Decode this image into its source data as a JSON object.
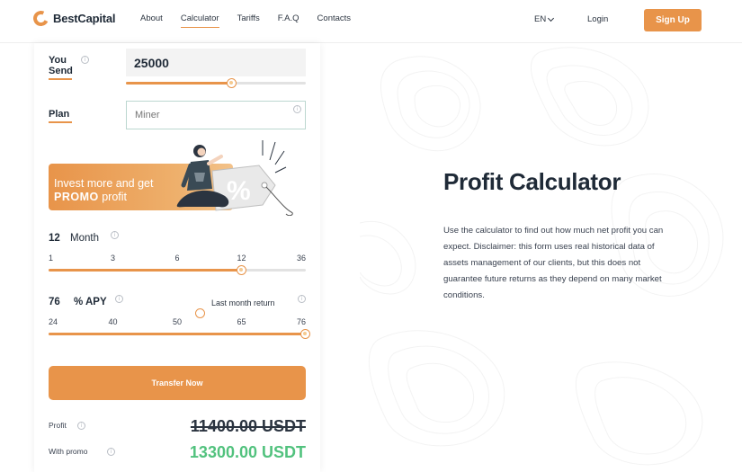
{
  "header": {
    "brand": "BestCapital",
    "nav": [
      {
        "label": "About"
      },
      {
        "label": "Calculator"
      },
      {
        "label": "Tariffs"
      },
      {
        "label": "F.A.Q"
      },
      {
        "label": "Contacts"
      }
    ],
    "active_nav": "Calculator",
    "language": "EN",
    "login_label": "Login",
    "signup_label": "Sign Up"
  },
  "calculator": {
    "send": {
      "label": "You Send",
      "value": "25000",
      "slider_fraction": 0.59
    },
    "plan": {
      "label": "Plan",
      "placeholder": "Miner"
    },
    "promo": {
      "line1": "Invest more and get",
      "line2_bold": "PROMO",
      "line2_rest": " profit",
      "badge": "%"
    },
    "months": {
      "value": "12",
      "label": "Month",
      "ticks": [
        "1",
        "3",
        "6",
        "12",
        "36"
      ],
      "selected": "12"
    },
    "apy": {
      "value": "76",
      "label": "% APY",
      "last_month_label": "Last month return",
      "ticks": [
        "24",
        "40",
        "50",
        "65",
        "76"
      ],
      "selected": "76"
    },
    "transfer_label": "Transfer Now",
    "profit_label": "Profit",
    "profit_value": "11400.00 USDT",
    "promo_label": "With promo",
    "promo_value": "13300.00 USDT"
  },
  "info": {
    "title": "Profit Calculator",
    "description": "Use the calculator to find out how much net profit you can expect. Disclaimer: this form uses real historical data of assets management of our clients, but this does not guarantee future returns as they depend on many market conditions."
  },
  "colors": {
    "accent": "#e8944a",
    "success": "#52c27e",
    "text": "#1f2a37"
  }
}
